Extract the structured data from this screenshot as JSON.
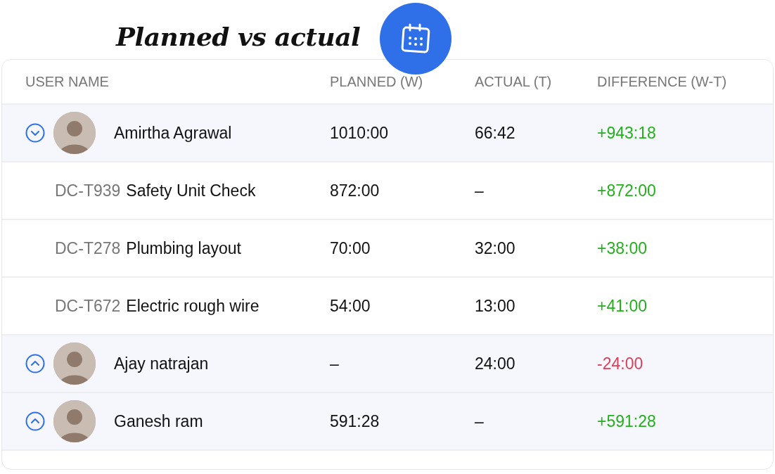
{
  "title": "Planned vs actual",
  "table": {
    "columns": [
      "USER NAME",
      "PLANNED (W)",
      "ACTUAL (T)",
      "DIFFERENCE (W-T)"
    ],
    "users": [
      {
        "name": "Amirtha Agrawal",
        "expanded": true,
        "planned": "1010:00",
        "actual": "66:42",
        "difference": "+943:18",
        "color": "#22b01b",
        "tasks": [
          {
            "id": "DC-T939",
            "name": "Safety Unit Check",
            "planned": "872:00",
            "actual": "–",
            "difference": "+872:00",
            "color": "#22b01b"
          },
          {
            "id": "DC-T278",
            "name": "Plumbing layout",
            "planned": "70:00",
            "actual": "32:00",
            "difference": "+38:00",
            "color": "#22b01b"
          },
          {
            "id": "DC-T672",
            "name": "Electric rough wire",
            "planned": "54:00",
            "actual": "13:00",
            "difference": "+41:00",
            "color": "#22b01b"
          }
        ]
      },
      {
        "name": "Ajay natrajan",
        "expanded": false,
        "planned": "–",
        "actual": "24:00",
        "difference": "-24:00",
        "color": "#d9415a"
      },
      {
        "name": "Ganesh ram",
        "expanded": false,
        "planned": "591:28",
        "actual": "–",
        "difference": "+591:28",
        "color": "#22b01b"
      }
    ]
  }
}
